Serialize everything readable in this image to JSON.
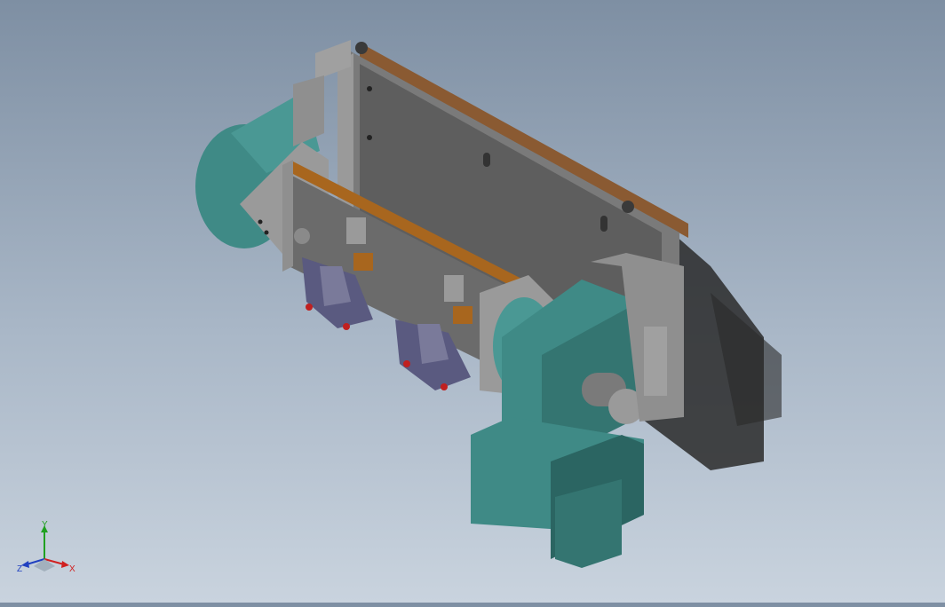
{
  "viewport": {
    "background_top": "#7e8fa3",
    "background_bottom": "#c9d3de"
  },
  "colors": {
    "teal": "#3f8a86",
    "teal_dark": "#2b6562",
    "plate_gray": "#6b6b6b",
    "plate_dark": "#4a4a4a",
    "frame_gray": "#8f8f8f",
    "wood": "#8a5a32",
    "orange_strip": "#a8661e",
    "shadow": "#2a2a2a",
    "fixture_purple": "#5a5a80"
  },
  "triad": {
    "x_label": "X",
    "y_label": "Y",
    "z_label": "Z",
    "x_color": "#d02020",
    "y_color": "#20a020",
    "z_color": "#2040c0"
  }
}
